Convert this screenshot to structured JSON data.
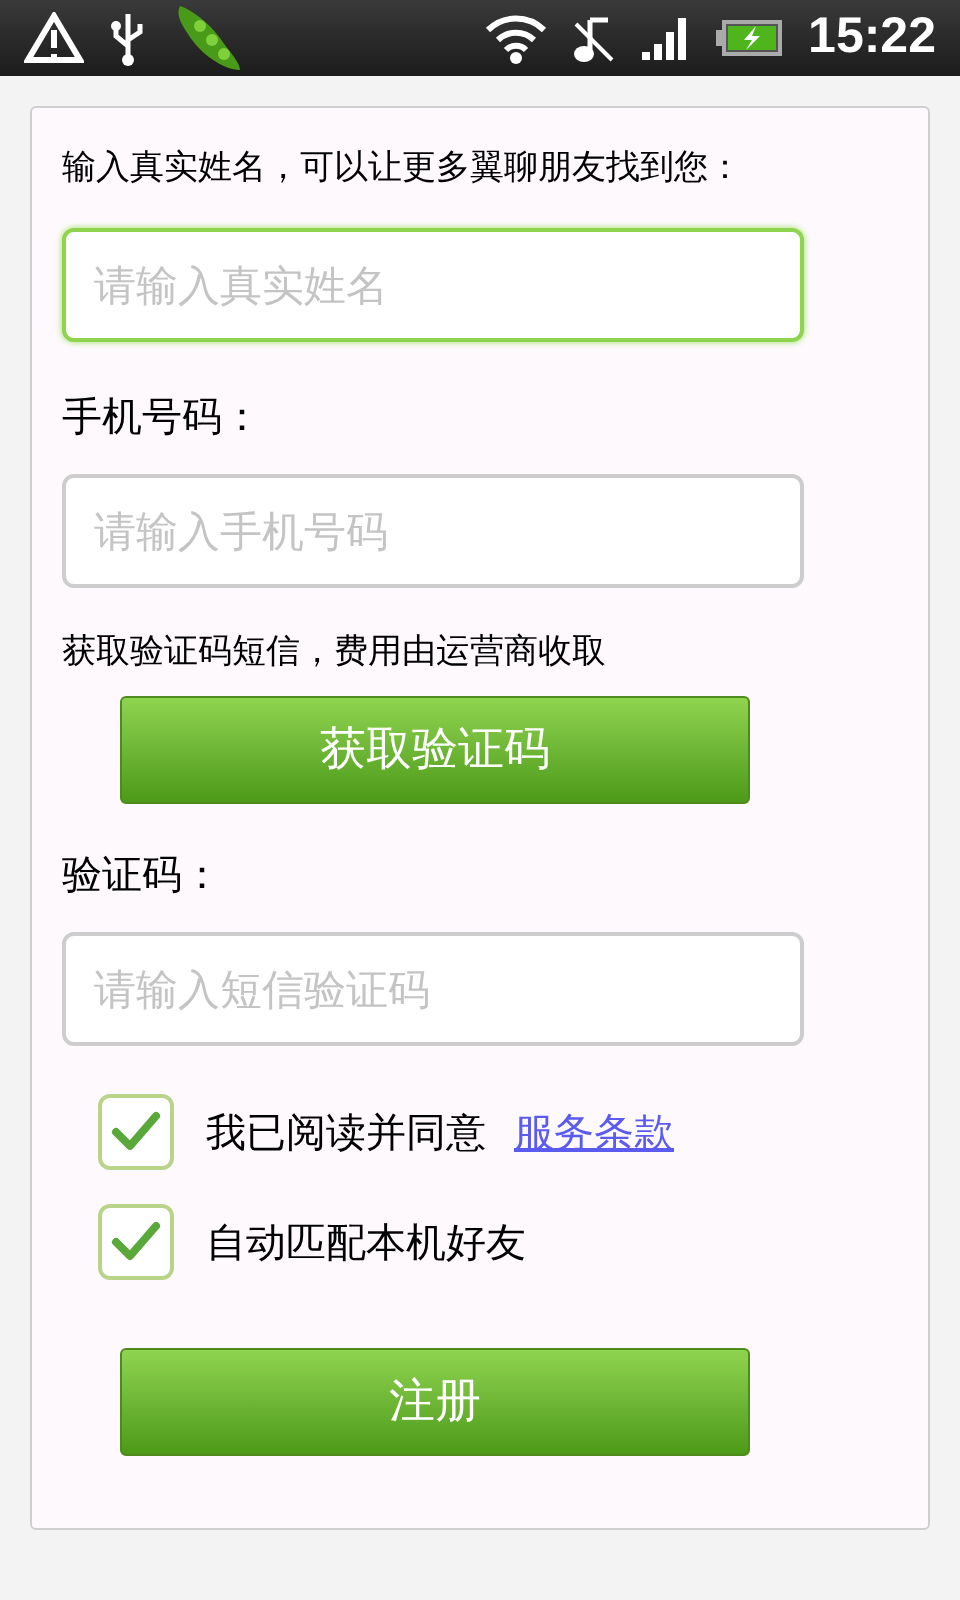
{
  "status_bar": {
    "time": "15:22"
  },
  "form": {
    "intro": "输入真实姓名，可以让更多翼聊朋友找到您：",
    "name_field": {
      "placeholder": "请输入真实姓名",
      "focused": true
    },
    "phone_label": "手机号码：",
    "phone_field": {
      "placeholder": "请输入手机号码",
      "focused": false
    },
    "sms_note": "获取验证码短信，费用由运营商收取",
    "get_code_button": "获取验证码",
    "code_label": "验证码：",
    "code_field": {
      "placeholder": "请输入短信验证码",
      "focused": false
    },
    "checkboxes": [
      {
        "label": "我已阅读并同意",
        "link": "服务条款",
        "checked": true
      },
      {
        "label": "自动匹配本机好友",
        "checked": true
      }
    ],
    "register_button": "注册"
  }
}
